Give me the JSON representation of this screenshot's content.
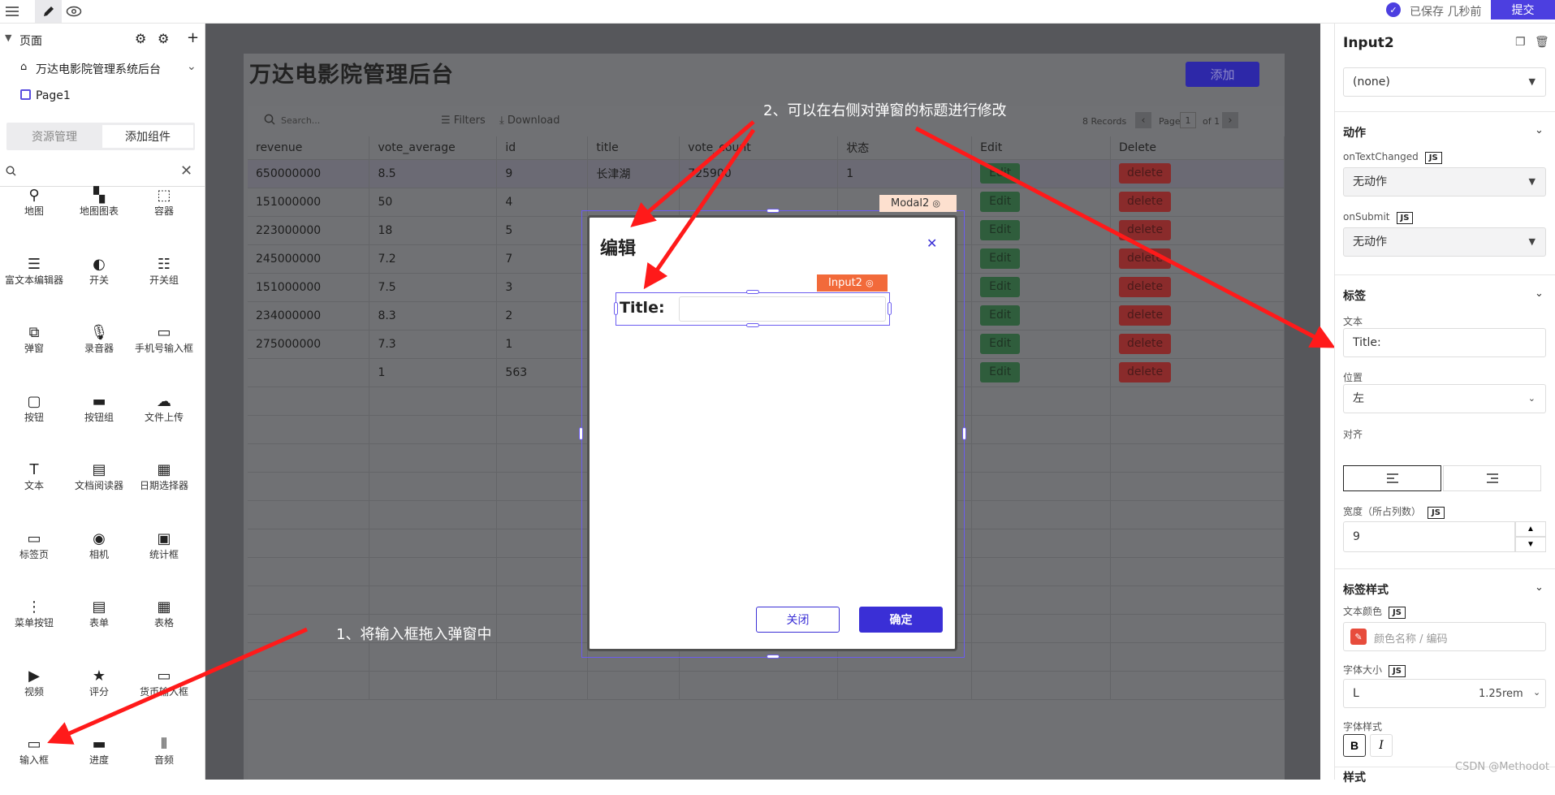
{
  "topbar": {
    "saved_text": "已保存 几秒前",
    "submit_label": "提交"
  },
  "left": {
    "pages_header": "页面",
    "pages": [
      "万达电影院管理系统后台",
      "Page1"
    ],
    "tab_resources": "资源管理",
    "tab_add": "添加组件",
    "search_placeholder": "",
    "components": [
      {
        "label": "地图",
        "icon": "map-pin-icon"
      },
      {
        "label": "地图图表",
        "icon": "map-chart-icon"
      },
      {
        "label": "容器",
        "icon": "container-icon"
      },
      {
        "label": "富文本编辑器",
        "icon": "rich-text-icon"
      },
      {
        "label": "开关",
        "icon": "toggle-icon"
      },
      {
        "label": "开关组",
        "icon": "toggle-group-icon"
      },
      {
        "label": "弹窗",
        "icon": "modal-icon"
      },
      {
        "label": "录音器",
        "icon": "microphone-icon"
      },
      {
        "label": "手机号输入框",
        "icon": "phone-input-icon"
      },
      {
        "label": "按钮",
        "icon": "button-icon"
      },
      {
        "label": "按钮组",
        "icon": "button-group-icon"
      },
      {
        "label": "文件上传",
        "icon": "upload-icon"
      },
      {
        "label": "文本",
        "icon": "text-icon"
      },
      {
        "label": "文档阅读器",
        "icon": "pdf-icon"
      },
      {
        "label": "日期选择器",
        "icon": "calendar-icon"
      },
      {
        "label": "标签页",
        "icon": "tabs-icon"
      },
      {
        "label": "相机",
        "icon": "camera-icon"
      },
      {
        "label": "统计框",
        "icon": "statistic-icon"
      },
      {
        "label": "菜单按钮",
        "icon": "menu-button-icon"
      },
      {
        "label": "表单",
        "icon": "form-icon"
      },
      {
        "label": "表格",
        "icon": "table-icon"
      },
      {
        "label": "视频",
        "icon": "video-icon"
      },
      {
        "label": "评分",
        "icon": "star-icon"
      },
      {
        "label": "货币输入框",
        "icon": "currency-input-icon"
      },
      {
        "label": "输入框",
        "icon": "input-icon"
      },
      {
        "label": "进度",
        "icon": "progress-icon"
      },
      {
        "label": "音频",
        "icon": "audio-icon"
      }
    ]
  },
  "app": {
    "title": "万达电影院管理后台",
    "add_label": "添加",
    "toolbar": {
      "search_placeholder": "Search...",
      "filters": "Filters",
      "download": "Download",
      "records": "8 Records",
      "page_label": "Page",
      "page_num": "1",
      "of_label": "of 1"
    },
    "columns": [
      "revenue",
      "vote_average",
      "id",
      "title",
      "vote_count",
      "状态",
      "Edit",
      "Delete"
    ],
    "rows": [
      [
        "650000000",
        "8.5",
        "9",
        "长津湖",
        "725900",
        "1"
      ],
      [
        "151000000",
        "50",
        "4",
        "",
        "",
        ""
      ],
      [
        "223000000",
        "18",
        "5",
        "",
        "",
        ""
      ],
      [
        "245000000",
        "7.2",
        "7",
        "",
        "",
        ""
      ],
      [
        "151000000",
        "7.5",
        "3",
        "",
        "",
        ""
      ],
      [
        "234000000",
        "8.3",
        "2",
        "",
        "",
        ""
      ],
      [
        "275000000",
        "7.3",
        "1",
        "",
        "",
        ""
      ],
      [
        "",
        "1",
        "563",
        "",
        "",
        ""
      ]
    ],
    "edit_label": "Edit",
    "delete_label": "delete"
  },
  "modal": {
    "tag": "Modal2",
    "title": "编辑",
    "input_tag": "Input2",
    "input_label": "Title:",
    "cancel_label": "关闭",
    "ok_label": "确定"
  },
  "annotations": {
    "step1": "1、将输入框拖入弹窗中",
    "step2": "2、可以在右侧对弹窗的标题进行修改"
  },
  "right": {
    "title": "Input2",
    "none_select": "(none)",
    "actions_header": "动作",
    "on_text_changed": "onTextChanged",
    "on_text_changed_value": "无动作",
    "on_submit": "onSubmit",
    "on_submit_value": "无动作",
    "label_header": "标签",
    "text_label": "文本",
    "text_value": "Title:",
    "position_label": "位置",
    "position_value": "左",
    "align_label": "对齐",
    "width_label": "宽度（所占列数）",
    "width_value": "9",
    "label_style_header": "标签样式",
    "text_color_label": "文本颜色",
    "text_color_placeholder": "颜色名称 / 编码",
    "font_size_label": "字体大小",
    "font_size_value": "L",
    "font_size_rem": "1.25rem",
    "font_style_label": "字体样式",
    "bold_label": "B",
    "italic_label": "I",
    "style_header": "样式",
    "js_badge": "JS"
  },
  "watermark": "CSDN @Methodot",
  "colors": {
    "accent": "#4c3fe0",
    "arrow": "#ff1a1a",
    "modal_tag_bg": "#fde0cf",
    "input_tag_bg": "#f26a3a"
  }
}
